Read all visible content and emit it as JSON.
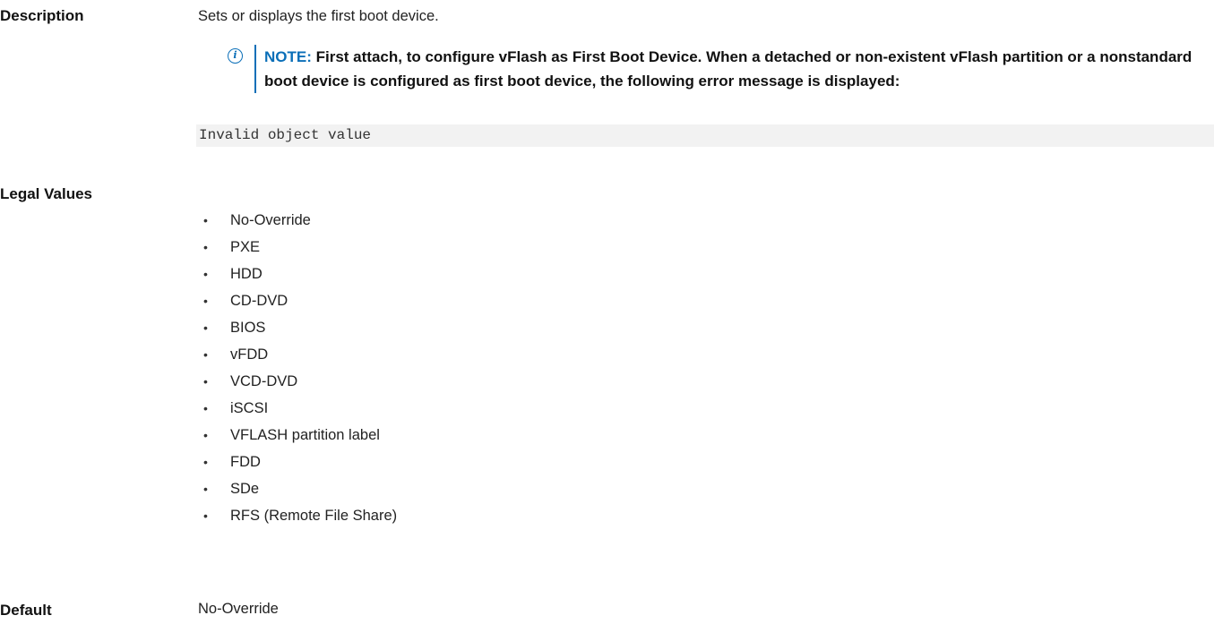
{
  "description": {
    "label": "Description",
    "text": "Sets or displays the first boot device.",
    "note": {
      "prefix": "NOTE:",
      "text": "First attach, to configure vFlash as First Boot Device. When a detached or non-existent vFlash partition or a nonstandard boot device is configured as first boot device, the following error message is displayed:"
    },
    "code": "Invalid object value"
  },
  "legal_values": {
    "label": "Legal Values",
    "items": [
      "No-Override",
      "PXE",
      "HDD",
      "CD-DVD",
      "BIOS",
      "vFDD",
      "VCD-DVD",
      "iSCSI",
      "VFLASH partition label",
      "FDD",
      "SDe",
      "RFS (Remote File Share)"
    ]
  },
  "default": {
    "label": "Default",
    "value": "No-Override"
  }
}
